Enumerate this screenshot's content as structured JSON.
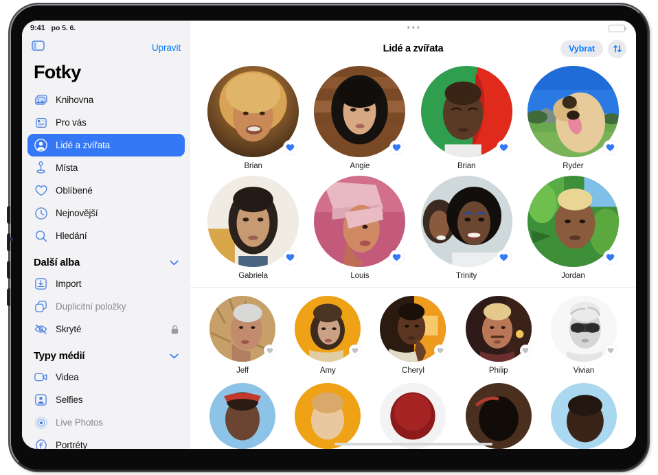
{
  "status_bar": {
    "time": "9:41",
    "date": "po 5. 6."
  },
  "sidebar": {
    "toggle_icon": "sidebar-toggle-icon",
    "edit_label": "Upravit",
    "app_title": "Fotky",
    "items": [
      {
        "label": "Knihovna",
        "icon": "photo-stack-icon",
        "selected": false,
        "dim": false
      },
      {
        "label": "Pro vás",
        "icon": "for-you-card-icon",
        "selected": false,
        "dim": false
      },
      {
        "label": "Lidé a zvířata",
        "icon": "person-circle-icon",
        "selected": true,
        "dim": false
      },
      {
        "label": "Místa",
        "icon": "map-pin-icon",
        "selected": false,
        "dim": false
      },
      {
        "label": "Oblíbené",
        "icon": "heart-icon",
        "selected": false,
        "dim": false
      },
      {
        "label": "Nejnovější",
        "icon": "clock-icon",
        "selected": false,
        "dim": false
      },
      {
        "label": "Hledání",
        "icon": "search-icon",
        "selected": false,
        "dim": false
      }
    ],
    "group_more_albums": {
      "title": "Další alba",
      "chevron": "chevron-down-icon",
      "items": [
        {
          "label": "Import",
          "icon": "import-tray-icon",
          "dim": false,
          "locked": false
        },
        {
          "label": "Duplicitní položky",
          "icon": "duplicate-squares-icon",
          "dim": true,
          "locked": false
        },
        {
          "label": "Skryté",
          "icon": "eye-slash-icon",
          "dim": false,
          "locked": true,
          "lock_icon": "lock-icon"
        }
      ]
    },
    "group_media_types": {
      "title": "Typy médií",
      "chevron": "chevron-down-icon",
      "items": [
        {
          "label": "Videa",
          "icon": "video-camera-icon",
          "dim": false
        },
        {
          "label": "Selfies",
          "icon": "selfie-person-icon",
          "dim": false
        },
        {
          "label": "Live Photos",
          "icon": "live-photos-icon",
          "dim": true
        },
        {
          "label": "Portréty",
          "icon": "portrait-f-icon",
          "dim": false
        }
      ]
    }
  },
  "main": {
    "grabber_icon": "multitasking-dots-icon",
    "battery_icon": "battery-icon",
    "title": "Lidé a zvířata",
    "select_label": "Vybrat",
    "sort_icon": "sort-arrows-icon",
    "rows": [
      {
        "size": "large",
        "people": [
          {
            "name": "Brian",
            "favorite": true
          },
          {
            "name": "Angie",
            "favorite": true
          },
          {
            "name": "Brian",
            "favorite": true
          },
          {
            "name": "Ryder",
            "favorite": true
          }
        ]
      },
      {
        "size": "large",
        "people": [
          {
            "name": "Gabriela",
            "favorite": true
          },
          {
            "name": "Louis",
            "favorite": true
          },
          {
            "name": "Trinity",
            "favorite": true
          },
          {
            "name": "Jordan",
            "favorite": true
          }
        ]
      },
      {
        "size": "small",
        "divider": true,
        "people": [
          {
            "name": "Jeff",
            "favorite": false
          },
          {
            "name": "Amy",
            "favorite": false
          },
          {
            "name": "Cheryl",
            "favorite": false
          },
          {
            "name": "Philip",
            "favorite": false
          },
          {
            "name": "Vivian",
            "favorite": false
          }
        ]
      },
      {
        "size": "small",
        "clipped": true,
        "people": [
          {
            "name": "",
            "favorite": false
          },
          {
            "name": "",
            "favorite": false
          },
          {
            "name": "",
            "favorite": false
          },
          {
            "name": "",
            "favorite": false
          },
          {
            "name": "",
            "favorite": false
          }
        ]
      }
    ]
  },
  "colors": {
    "accent_blue": "#0a7bff",
    "selected_blue": "#3478f6",
    "sidebar_bg": "#f3f3f6",
    "favorite_blue": "#3478f6",
    "favorite_gray": "#c2c2c7"
  }
}
